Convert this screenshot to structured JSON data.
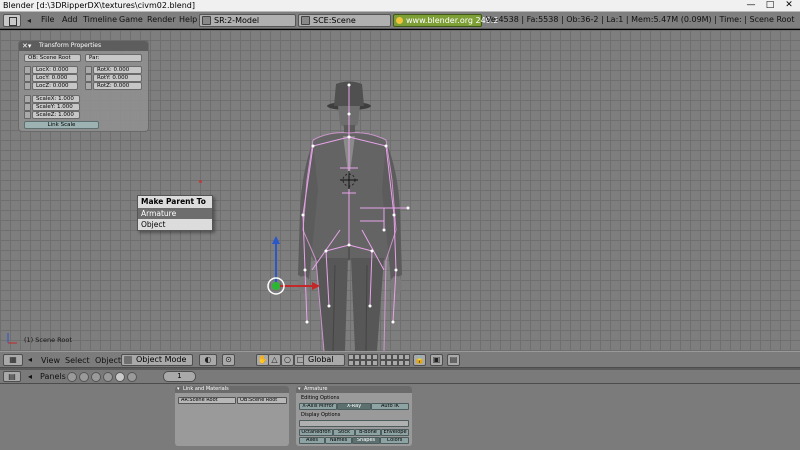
{
  "window": {
    "title": "Blender [d:\\3DRipperDX\\textures\\civm02.blend]",
    "buttons": [
      "—",
      "□",
      "✕"
    ]
  },
  "menubar": {
    "items": [
      "File",
      "Add",
      "Timeline",
      "Game",
      "Render",
      "Help"
    ],
    "screen": "SR:2-Model",
    "scene": "SCE:Scene",
    "link": "www.blender.org 249.2",
    "stats": "Ve:4538 | Fa:5538 | Ob:36-2 | La:1  | Mem:5.47M (0.09M)  | Time: | Scene Root"
  },
  "transform_panel": {
    "title": "Transform Properties",
    "ob": "OB: Scene Root",
    "par": "Par:",
    "loc": [
      "LocX: 0.000",
      "LocY: 0.000",
      "LocZ: 0.000"
    ],
    "rot": [
      "RotX: 0.000",
      "RotY: 0.000",
      "RotZ: 0.000"
    ],
    "scale": [
      "ScaleX: 1.000",
      "ScaleY: 1.000",
      "ScaleZ: 1.000"
    ],
    "link_scale": "Link Scale"
  },
  "popup": {
    "title": "Make Parent To",
    "items": [
      "Armature",
      "Object"
    ],
    "selected": "Armature"
  },
  "viewport": {
    "status": "(1) Scene Root"
  },
  "view_header": {
    "menus": [
      "View",
      "Select",
      "Object"
    ],
    "mode": "Object Mode",
    "orientation": "Global"
  },
  "buttons_header": {
    "panels_label": "Panels",
    "frame": "1"
  },
  "link_materials": {
    "title": "Link and Materials",
    "ar": "AR:Scene Root",
    "ob": "OB:Scene Root"
  },
  "armature": {
    "title": "Armature",
    "editing_label": "Editing Options",
    "editing": [
      "X-Axis Mirror",
      "X-Ray",
      "Auto IK"
    ],
    "display_label": "Display Options",
    "display_row1": [
      "Octahedron",
      "Stick",
      "B-Bone",
      "Envelope"
    ],
    "display_row2": [
      "Axes",
      "Names",
      "Shapes",
      "Colors"
    ]
  },
  "colors": {
    "viewport_bg": "#7e7e7e",
    "grid": "#6f6f6f",
    "bone_outline": "#e9a3ea",
    "link_green": "#7d9f36"
  }
}
